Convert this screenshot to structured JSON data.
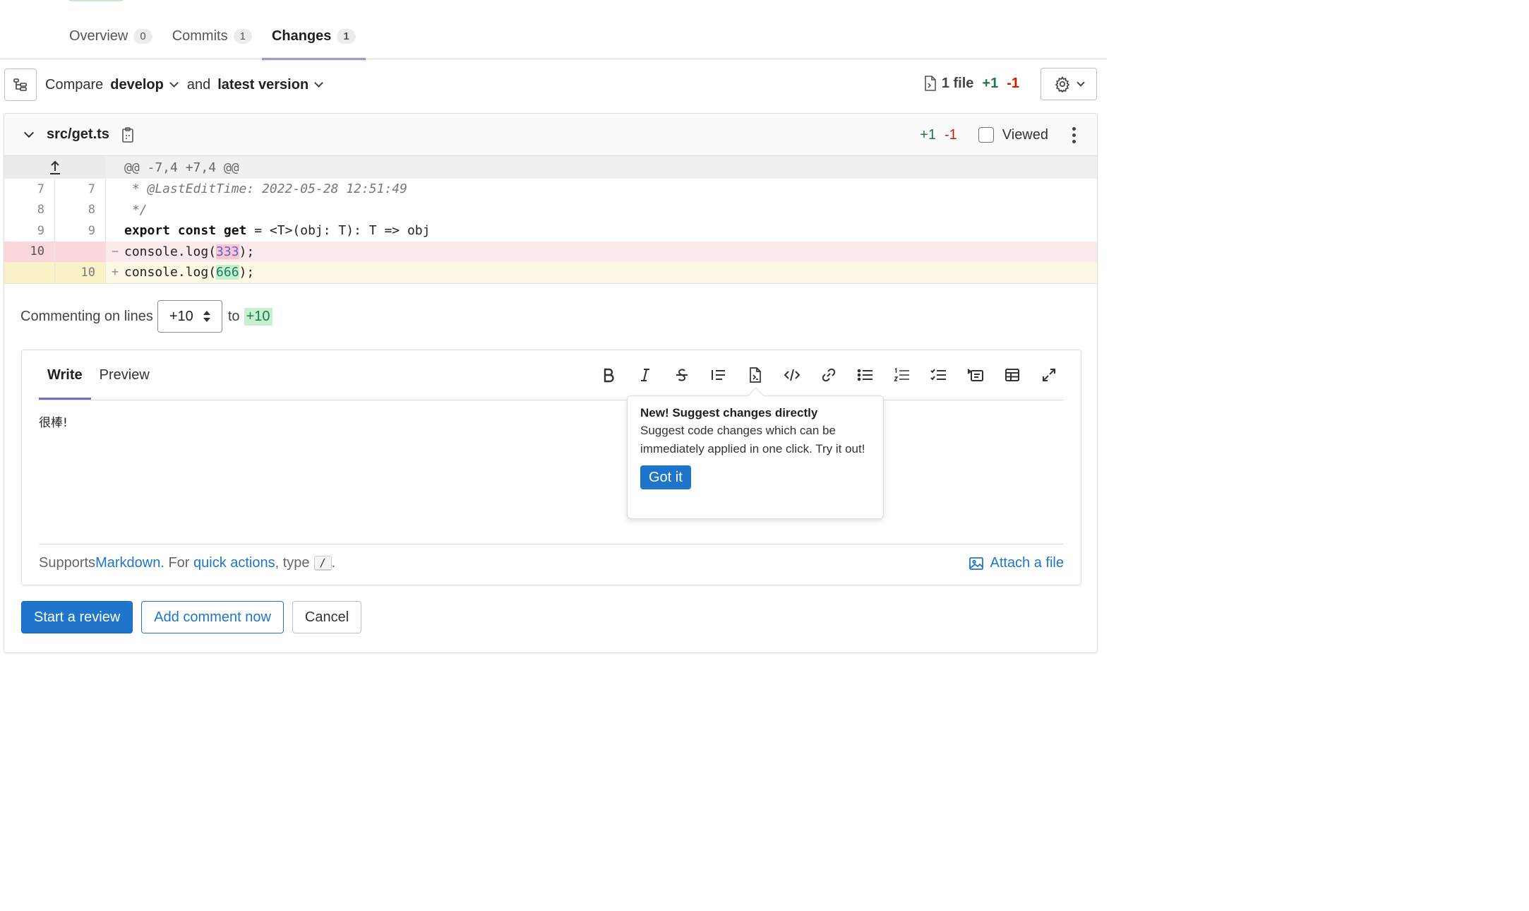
{
  "tabs": [
    {
      "label": "Overview",
      "count": "0"
    },
    {
      "label": "Commits",
      "count": "1"
    },
    {
      "label": "Changes",
      "count": "1"
    }
  ],
  "compare": {
    "compare_label": "Compare",
    "base_branch": "develop",
    "and_label": "and",
    "target_version": "latest version",
    "files_label": "1 file",
    "additions": "+1",
    "deletions": "-1"
  },
  "file": {
    "path": "src/get.ts",
    "additions": "+1",
    "deletions": "-1",
    "viewed_label": "Viewed"
  },
  "diff": {
    "hunk_header": "@@ -7,4 +7,4 @@",
    "lines": [
      {
        "old": "7",
        "new": "7",
        "type": "context",
        "text": " * @LastEditTime: 2022-05-28 12:51:49"
      },
      {
        "old": "8",
        "new": "8",
        "type": "context",
        "text": " */"
      },
      {
        "old": "9",
        "new": "9",
        "type": "context",
        "kw1": "export const get",
        "rest": " = <T>(obj: T): T => obj"
      },
      {
        "old": "10",
        "new": "",
        "type": "del",
        "sign": "−",
        "pre": "console.log(",
        "hl": "333",
        "post": ");"
      },
      {
        "old": "",
        "new": "10",
        "type": "add",
        "sign": "+",
        "pre": "console.log(",
        "hl": "666",
        "post": ");"
      }
    ]
  },
  "commenting": {
    "prefix": "Commenting on lines",
    "start_line": "+10",
    "to_label": "to",
    "end_line": "+10"
  },
  "editor": {
    "write_tab": "Write",
    "preview_tab": "Preview",
    "content": "很棒!",
    "footer_supports": "Supports ",
    "footer_markdown": "Markdown",
    "footer_for": ". For ",
    "footer_quick_actions": "quick actions",
    "footer_type": ", type",
    "footer_kbd": "/",
    "footer_end": ".",
    "attach_label": "Attach a file",
    "toolbar_icons": [
      "bold-icon",
      "italic-icon",
      "strikethrough-icon",
      "quote-icon",
      "suggestion-icon",
      "code-icon",
      "link-icon",
      "bullet-list-icon",
      "numbered-list-icon",
      "task-list-icon",
      "collapsible-section-icon",
      "table-icon",
      "fullscreen-icon"
    ]
  },
  "popover": {
    "title": "New! Suggest changes directly",
    "body": "Suggest code changes which can be immediately applied in one click. Try it out!",
    "button": "Got it"
  },
  "actions": {
    "start_review": "Start a review",
    "add_comment": "Add comment now",
    "cancel": "Cancel"
  },
  "colors": {
    "accent": "#1f75cb",
    "tab_underline": "#6e71c9",
    "addition": "#217645",
    "deletion": "#c91c00"
  }
}
